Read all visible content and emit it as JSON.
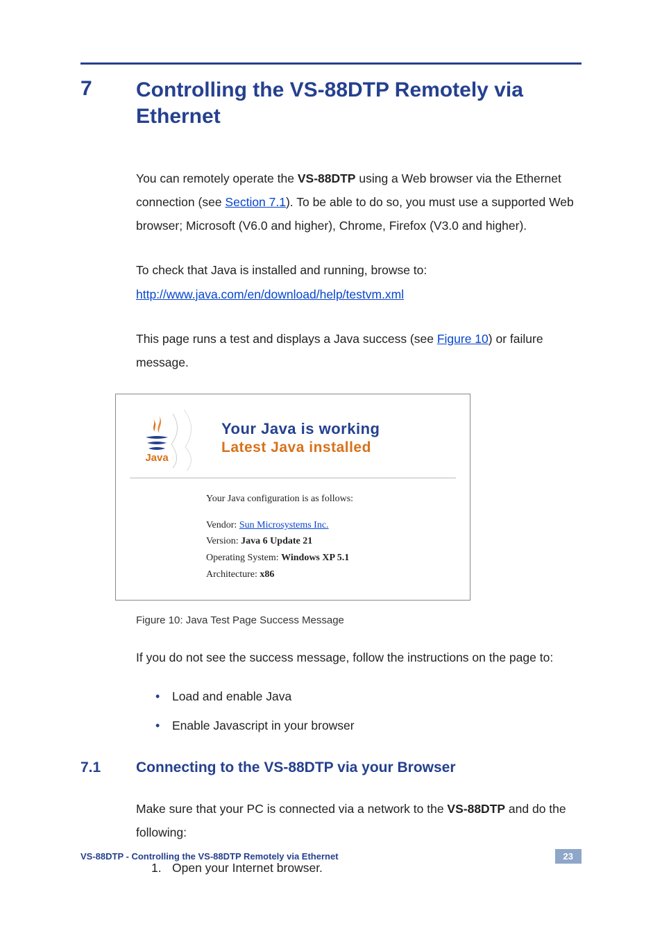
{
  "section": {
    "number": "7",
    "title": "Controlling the VS-88DTP Remotely via Ethernet"
  },
  "para1": {
    "prefix": "You can remotely operate the ",
    "bold1": "VS-88DTP",
    "mid1": " using a Web browser via the Ethernet connection (see ",
    "link1": "Section 7.1",
    "mid2": "). To be able to do so, you must use a supported Web browser; Microsoft (V6.0 and higher), Chrome, Firefox (V3.0 and higher)."
  },
  "para2": {
    "line1": "To check that Java is installed and running, browse to:",
    "link": "http://www.java.com/en/download/help/testvm.xml"
  },
  "para3": {
    "prefix": "This page runs a test and displays a Java success (see ",
    "link": "Figure 10",
    "suffix": ") or failure message."
  },
  "figure": {
    "logo_text": "Java",
    "title1": "Your Java is working",
    "title2": "Latest Java installed",
    "config_line": "Your Java configuration is as follows:",
    "vendor_label": "Vendor: ",
    "vendor_value": "Sun Microsystems Inc.",
    "version_label": "Version: ",
    "version_value": "Java 6 Update 21",
    "os_label": "Operating System: ",
    "os_value": "Windows XP 5.1",
    "arch_label": "Architecture: ",
    "arch_value": "x86",
    "caption": "Figure 10: Java Test Page Success Message"
  },
  "para4": "If you do not see the success message, follow the instructions on the page to:",
  "bullets": [
    "Load and enable Java",
    "Enable Javascript in your browser"
  ],
  "subsection": {
    "number": "7.1",
    "title": "Connecting to the VS-88DTP via your Browser"
  },
  "para5": {
    "prefix": "Make sure that your PC is connected via a network to the ",
    "bold": "VS-88DTP",
    "suffix": " and do the following:"
  },
  "numbered": [
    "Open your Internet browser."
  ],
  "footer": {
    "left": "VS-88DTP - Controlling the VS-88DTP Remotely via Ethernet",
    "page": "23"
  }
}
